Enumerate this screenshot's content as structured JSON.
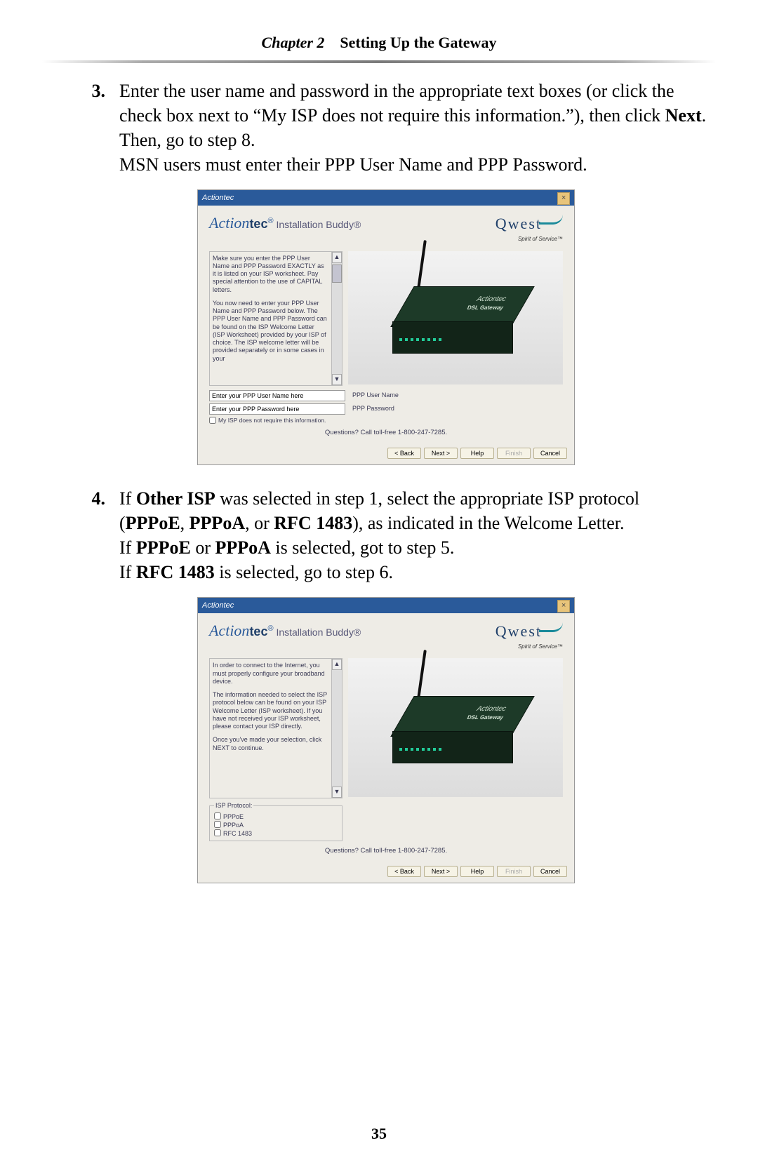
{
  "header": {
    "chapter": "Chapter 2",
    "title": "Setting Up the Gateway"
  },
  "footer": {
    "page": "35"
  },
  "step3": {
    "num": "3.",
    "line1a": "Enter the user name and password in the appropriate text boxes (or click the check box next to “My ",
    "line1b": "ISP",
    "line1c": " does not require this information.”), then click ",
    "line1d": "Next",
    "line1e": ". Then, go to step 8.",
    "line2a": "MSN",
    "line2b": " users must enter their ",
    "line2c": "PPP",
    "line2d": " User Name and ",
    "line2e": "PPP",
    "line2f": " Password."
  },
  "step4": {
    "num": "4.",
    "l1a": "If ",
    "l1b": "Other ISP",
    "l1c": " was selected in step 1, select the appropriate ",
    "l1d": "ISP",
    "l1e": " protocol (",
    "l1f": "PPPoE",
    "l1g": ", ",
    "l1h": "PPPoA",
    "l1i": ", or ",
    "l1j": "RFC 1483",
    "l1k": "), as indicated in the Welcome Letter.",
    "l2a": "If ",
    "l2b": "PPPoE",
    "l2c": " or ",
    "l2d": "PPPoA",
    "l2e": " is selected, got to step 5.",
    "l3a": "If ",
    "l3b": "RFC 1483",
    "l3c": " is selected, go to step 6."
  },
  "dlg": {
    "titlebar": "Actiontec",
    "close": "×",
    "brandAct": "Action",
    "brandTec": "tec",
    "brandReg": "®",
    "brandSub": " Installation Buddy®",
    "qwest": "Qwest",
    "sos": "Spirit of Service™",
    "device_a": "Actiontec",
    "device_g": "DSL Gateway",
    "questions": "Questions? Call toll-free 1-800-247-7285.",
    "btn_back": "< Back",
    "btn_next": "Next >",
    "btn_help": "Help",
    "btn_finish": "Finish",
    "btn_cancel": "Cancel"
  },
  "dlg1": {
    "p1": "Make sure you enter the PPP User Name and PPP Password EXACTLY as it is listed on your ISP worksheet. Pay special attention to the use of CAPITAL letters.",
    "p2": "You now need to enter your PPP User Name and PPP Password below. The PPP User Name and PPP Password can be found on the ISP Welcome Letter (ISP Worksheet) provided by your ISP of choice. The ISP welcome letter will be provided separately or in some cases in your",
    "in_user": "Enter your PPP User Name here",
    "in_pass": "Enter your PPP Password here",
    "lab_user": "PPP User Name",
    "lab_pass": "PPP Password",
    "chk": "My ISP does not require this information."
  },
  "dlg2": {
    "p1": "In order to connect to the Internet, you must properly configure your broadband device.",
    "p2": "The information needed to select the ISP protocol below can be found on your ISP Welcome Letter (ISP worksheet). If you have not received your ISP worksheet, please contact your ISP directly.",
    "p3": "Once you've made your selection, click NEXT to continue.",
    "legend": "ISP Protocol:",
    "o1": "PPPoE",
    "o2": "PPPoA",
    "o3": "RFC 1483"
  }
}
